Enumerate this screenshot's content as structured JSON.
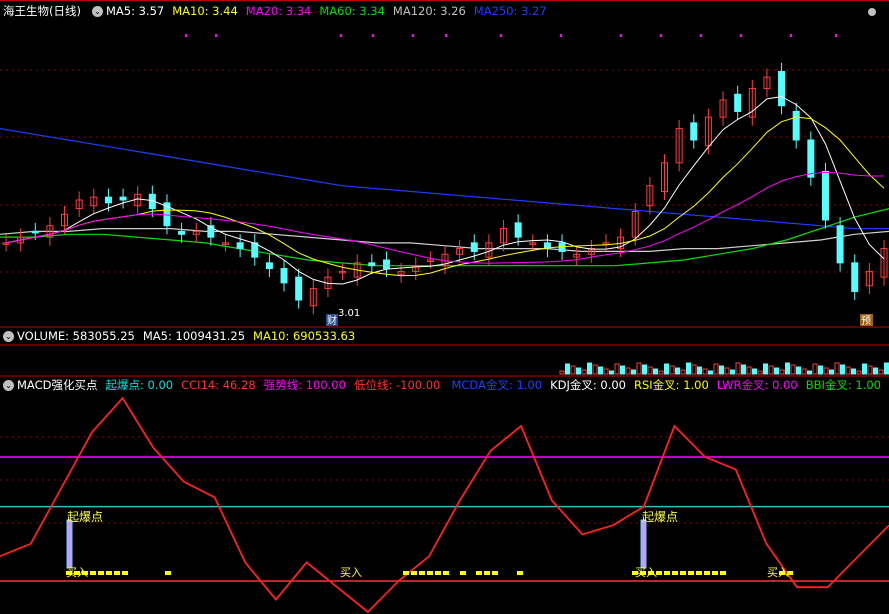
{
  "main_header": {
    "stock": "海王生物(日线)",
    "ma": [
      {
        "label": "MA5: 3.57",
        "color": "#ffffff"
      },
      {
        "label": "MA10: 3.44",
        "color": "#ffff00"
      },
      {
        "label": "MA20: 3.34",
        "color": "#ff00ff"
      },
      {
        "label": "MA60: 3.34",
        "color": "#00e000"
      },
      {
        "label": "MA120: 3.26",
        "color": "#c0c0c0"
      },
      {
        "label": "MA250: 3.27",
        "color": "#1e3cff"
      }
    ]
  },
  "volume_header": {
    "volume": "VOLUME: 583055.25",
    "ma5": "MA5: 1009431.25",
    "ma10": "MA10: 690533.63",
    "colors": {
      "volume": "#ffffff",
      "ma5": "#ffffff",
      "ma10": "#ffff00"
    }
  },
  "macd_header": {
    "title": "MACD强化买点",
    "items": [
      {
        "label": "起爆点: 0.00",
        "color": "#00e0e0"
      },
      {
        "label": "CCI14: 46.28",
        "color": "#ff3030"
      },
      {
        "label": "强势线: 100.00",
        "color": "#ff00ff"
      },
      {
        "label": "低位线: -100.00",
        "color": "#ff3030"
      }
    ],
    "right_items": [
      {
        "label": "MCDA金叉: 1.00",
        "color": "#2040ff"
      },
      {
        "label": "KDJ金叉: 0.00",
        "color": "#ffffff"
      },
      {
        "label": "RSI金叉: 1.00",
        "color": "#ffff00"
      },
      {
        "label": "LWR金叉: 0.00",
        "color": "#ff00ff"
      },
      {
        "label": "BBI金叉: 1.00",
        "color": "#00e000"
      }
    ]
  },
  "annotations": {
    "low_price": "3.01",
    "cai_badge": "财",
    "yu_badge": "预",
    "qibao_label": "起爆点",
    "buy_label": "买入"
  },
  "chart_data": {
    "type": "line",
    "title": "海王生物(日线)",
    "series": [
      {
        "name": "MA250",
        "values": [
          3.62,
          3.6,
          3.58,
          3.56,
          3.54,
          3.52,
          3.5,
          3.48,
          3.46,
          3.44,
          3.42,
          3.41,
          3.4,
          3.39,
          3.38,
          3.37,
          3.36,
          3.35,
          3.34,
          3.33,
          3.32,
          3.31,
          3.3,
          3.29,
          3.28,
          3.27,
          3.27
        ]
      },
      {
        "name": "MA120",
        "values": [
          3.25,
          3.26,
          3.26,
          3.27,
          3.27,
          3.27,
          3.26,
          3.26,
          3.25,
          3.24,
          3.23,
          3.22,
          3.22,
          3.21,
          3.2,
          3.2,
          3.2,
          3.19,
          3.19,
          3.19,
          3.2,
          3.2,
          3.21,
          3.22,
          3.23,
          3.25,
          3.26
        ]
      },
      {
        "name": "MA60",
        "values": [
          3.24,
          3.24,
          3.25,
          3.25,
          3.24,
          3.23,
          3.22,
          3.2,
          3.18,
          3.16,
          3.15,
          3.14,
          3.14,
          3.14,
          3.14,
          3.14,
          3.14,
          3.14,
          3.14,
          3.15,
          3.16,
          3.18,
          3.2,
          3.23,
          3.27,
          3.31,
          3.34
        ]
      },
      {
        "name": "CCI14",
        "values": [
          -60,
          -40,
          50,
          140,
          195,
          115,
          60,
          35,
          -70,
          -130,
          -70,
          -110,
          -150,
          -100,
          -60,
          30,
          110,
          150,
          30,
          -25,
          -10,
          20,
          150,
          100,
          80,
          -40,
          -110,
          -110,
          -60,
          -10
        ]
      },
      {
        "name": "强势线",
        "values": [
          100
        ]
      },
      {
        "name": "低位线",
        "values": [
          -100
        ]
      }
    ],
    "ylim_main": [
      2.95,
      4.0
    ],
    "ylim_cci": [
      -150,
      200
    ],
    "grid": true,
    "legend": "top-left"
  }
}
